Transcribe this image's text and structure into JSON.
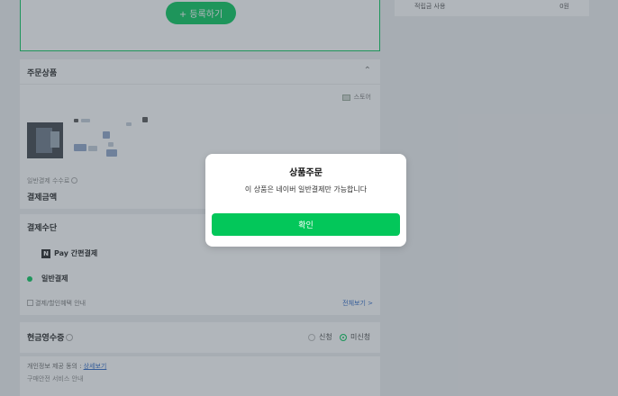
{
  "register": {
    "button_label": "+ 등록하기"
  },
  "right_panel": {
    "left_text": "적립금 사용",
    "right_text": "0원"
  },
  "products": {
    "title": "주문상품",
    "store_tag": "스토어"
  },
  "fees": {
    "fee_label": "일반결제 수수료",
    "amount_label": "결제금액"
  },
  "payment": {
    "title": "결제수단",
    "npay_icon_letter": "N",
    "npay_label": "Pay 간편결제",
    "general_label": "일반결제",
    "benefit_label": "결제/할인혜택 안내",
    "view_all_label": "전체보기 >"
  },
  "receipt": {
    "title": "현금영수증",
    "options": [
      "신청",
      "미신청"
    ],
    "selected": "미신청"
  },
  "terms": {
    "line1": "개인정보 제공 동의 :",
    "line1_link": "상세보기",
    "line2": "구매안전 서비스 안내"
  },
  "modal": {
    "title": "상품주문",
    "message": "이 상품은 네이버 일반결제만 가능합니다",
    "confirm_label": "확인"
  },
  "colors": {
    "accent": "#03c75a",
    "link": "#2a66c5"
  }
}
